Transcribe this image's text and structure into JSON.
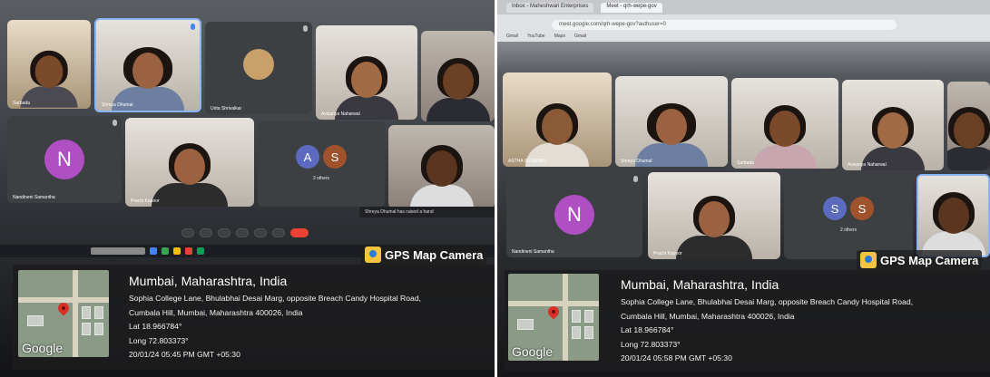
{
  "overlay_brand": "GPS Map Camera",
  "google_mark": "Google",
  "left_photo": {
    "meeting_tiles": [
      {
        "id": "l1",
        "label": "Sarbada",
        "kind": "cam"
      },
      {
        "id": "l2",
        "label": "Shreya Dhumal",
        "kind": "cam"
      },
      {
        "id": "l3",
        "label": "Urita Shrivalkar",
        "kind": "avatar"
      },
      {
        "id": "l4",
        "label": "Avisariya Naharwal",
        "kind": "cam"
      },
      {
        "id": "l5",
        "label": "",
        "kind": "cam"
      },
      {
        "id": "l6",
        "label": "Nandineni Samantha",
        "kind": "letter",
        "letter": "N"
      },
      {
        "id": "l7",
        "label": "Prachi Kapoor",
        "kind": "cam"
      },
      {
        "id": "l8",
        "label": "2 others",
        "kind": "pair",
        "letters": [
          "A",
          "S"
        ]
      },
      {
        "id": "l9",
        "label": "",
        "kind": "cam"
      }
    ],
    "raise_hand_text": "Shreya Dhumal has raised a hand",
    "gps": {
      "city": "Mumbai, Maharashtra, India",
      "address_line1": "Sophia College Lane, Bhulabhai Desai Marg, opposite Breach Candy Hospital Road,",
      "address_line2": "Cumbala Hill, Mumbai, Maharashtra 400026, India",
      "lat": "Lat 18.966784°",
      "long": "Long 72.803373°",
      "datetime": "20/01/24 05:45 PM GMT +05:30"
    }
  },
  "right_photo": {
    "browser_tabs": [
      "Inbox - Maheshwari Enterprises",
      "Meet - qrh-wepe-gov"
    ],
    "url": "meet.google.com/qrh-wepe-gov?authuser=0",
    "bookmarks": [
      "Gmail",
      "YouTube",
      "Maps",
      "Gmail"
    ],
    "meeting_tiles": [
      {
        "id": "r1",
        "label": "ASTHA SENAPATI",
        "kind": "cam"
      },
      {
        "id": "r2",
        "label": "Shreya Dhumal",
        "kind": "cam"
      },
      {
        "id": "r3",
        "label": "Sarbada",
        "kind": "cam"
      },
      {
        "id": "r4",
        "label": "Avisariya Naharwal",
        "kind": "cam"
      },
      {
        "id": "r5",
        "label": "",
        "kind": "cam"
      },
      {
        "id": "r6",
        "label": "Nandineni Samantha",
        "kind": "letter",
        "letter": "N"
      },
      {
        "id": "r7",
        "label": "Prachi Kapoor",
        "kind": "cam"
      },
      {
        "id": "r8",
        "label": "2 others",
        "kind": "pair",
        "letters": [
          "S",
          "S"
        ]
      },
      {
        "id": "r9",
        "label": "",
        "kind": "cam"
      }
    ],
    "gps": {
      "city": "Mumbai, Maharashtra, India",
      "address_line1": "Sophia College Lane, Bhulabhai Desai Marg, opposite Breach Candy Hospital Road,",
      "address_line2": "Cumbala Hill, Mumbai, Maharashtra 400026, India",
      "lat": "Lat 18.966784°",
      "long": "Long 72.803373°",
      "datetime": "20/01/24 05:58 PM GMT +05:30"
    }
  },
  "colors": {
    "avatar_purple": "#b04fc4",
    "avatar_blue": "#5c6bc0",
    "avatar_brown": "#a0522d",
    "end_call_red": "#ea4335"
  }
}
